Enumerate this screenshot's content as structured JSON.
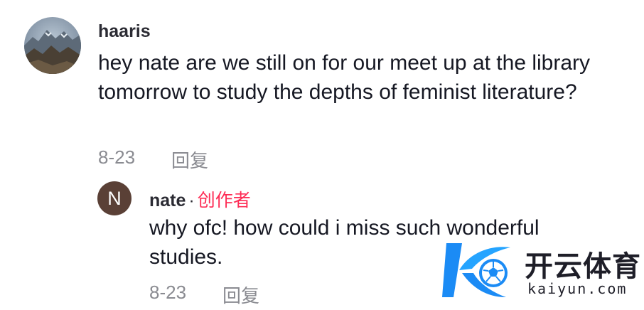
{
  "comment": {
    "username": "haaris",
    "text": "hey nate are we still on for our meet up at the library tomorrow to study the depths of feminist literature?",
    "date": "8-23",
    "reply_label": "回复"
  },
  "reply": {
    "avatar_initial": "N",
    "username": "nate",
    "separator": "·",
    "creator_badge": "创作者",
    "text": "why ofc! how could i miss such wonderful studies.",
    "date": "8-23",
    "reply_label": "回复"
  },
  "watermark": {
    "name_cn": "开云体育",
    "domain": "kaiyun.com"
  },
  "colors": {
    "creator_badge": "#fe2c55",
    "meta_text": "#8a8b91",
    "logo_blue": "#1b8bf5"
  }
}
